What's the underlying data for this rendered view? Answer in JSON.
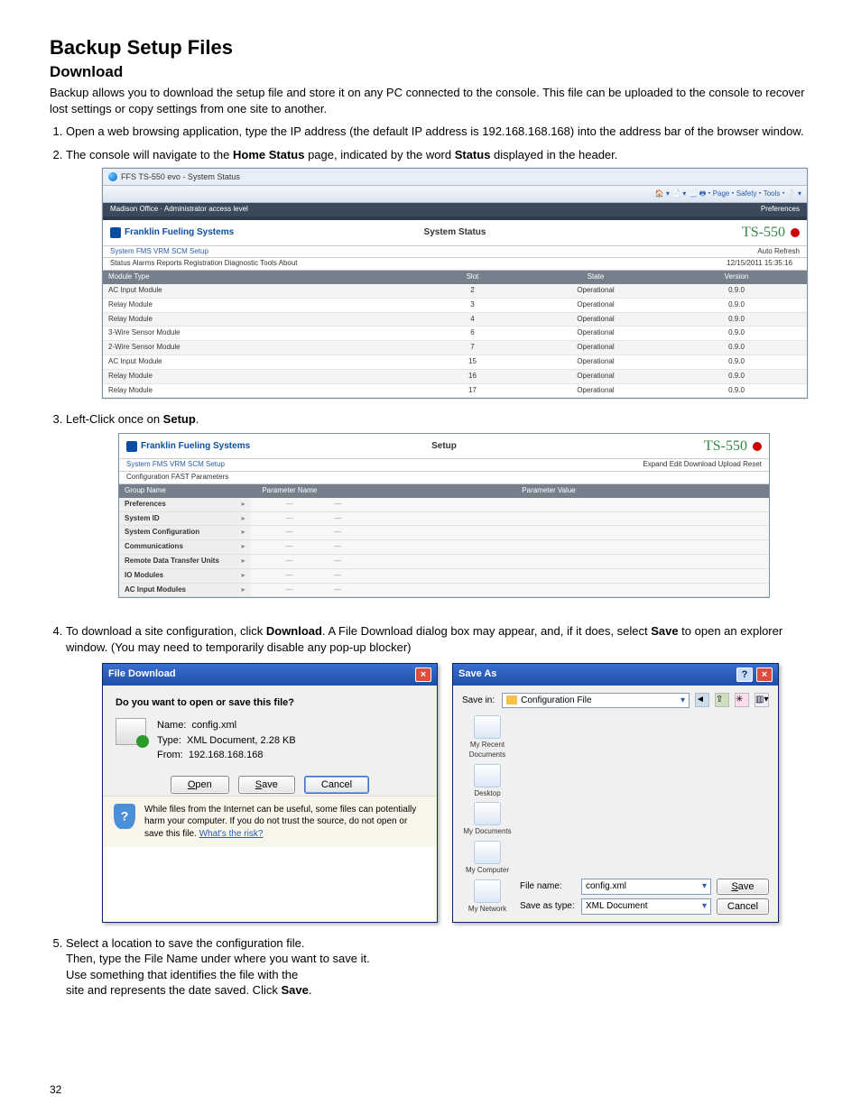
{
  "page_number": "32",
  "headings": {
    "title": "Backup Setup Files",
    "subtitle": "Download"
  },
  "intro": "Backup allows you to download the setup file and store it on any PC connected to the console. This file can be uploaded to the console to recover lost settings or copy settings from one site to another.",
  "steps": {
    "s1a": "Open a web browsing application, type the IP address (the default IP address is 192.168.168.168) into the address bar of the browser window.",
    "s2a": "The console will navigate to the ",
    "s2b": "Home Status",
    "s2c": " page, indicated by the word ",
    "s2d": "Status",
    "s2e": " displayed in the header.",
    "s3a": "Left-Click once on ",
    "s3b": "Setup",
    "s3c": ".",
    "s4a": "To download a site configuration, click ",
    "s4b": "Download",
    "s4c": ". A File Download dialog box may appear, and, if it does, select ",
    "s4d": "Save",
    "s4e": " to open an explorer window.  (You may need to temporarily disable any pop-up blocker)",
    "s5a": "Select a location to save the configuration file.",
    "s5b": "Then, type the File Name under where you want to save it.",
    "s5c": "Use something that identifies the file with the",
    "s5d": "site and represents the date saved. Click ",
    "s5e": "Save",
    "s5f": "."
  },
  "shot1": {
    "tab_title": "FFS TS-550 evo - System Status",
    "ie_menu": "Page ▾   Safety ▾   Tools ▾",
    "site_bar_left": "Madison Office · Administrator access level",
    "site_bar_right": "Preferences",
    "brand": "Franklin Fueling Systems",
    "page_title": "System Status",
    "model": "TS-550",
    "nav_left": "System   FMS   VRM   SCM   Setup",
    "nav_right": "Auto Refresh",
    "sub_left": "Status   Alarms   Reports   Registration   Diagnostic   Tools   About",
    "timestamp": "12/15/2011 15:35:16",
    "cols": {
      "c1": "Module Type",
      "c2": "Slot",
      "c3": "State",
      "c4": "Version"
    },
    "rows": [
      {
        "t": "AC Input Module",
        "s": "2",
        "st": "Operational",
        "v": "0.9.0"
      },
      {
        "t": "Relay Module",
        "s": "3",
        "st": "Operational",
        "v": "0.9.0"
      },
      {
        "t": "Relay Module",
        "s": "4",
        "st": "Operational",
        "v": "0.9.0"
      },
      {
        "t": "3-Wire Sensor Module",
        "s": "6",
        "st": "Operational",
        "v": "0.9.0"
      },
      {
        "t": "2-Wire Sensor Module",
        "s": "7",
        "st": "Operational",
        "v": "0.9.0"
      },
      {
        "t": "AC Input Module",
        "s": "15",
        "st": "Operational",
        "v": "0.9.0"
      },
      {
        "t": "Relay Module",
        "s": "16",
        "st": "Operational",
        "v": "0.9.0"
      },
      {
        "t": "Relay Module",
        "s": "17",
        "st": "Operational",
        "v": "0.9.0"
      }
    ]
  },
  "shot2": {
    "brand": "Franklin Fueling Systems",
    "page_title": "Setup",
    "model": "TS-550",
    "nav_left": "System   FMS   VRM   SCM   Setup",
    "nav_right": "Expand   Edit   Download   Upload   Reset",
    "sub_left": "Configuration   FAST   Parameters",
    "cols": {
      "c1": "Group Name",
      "c2": "Parameter Name",
      "c3": "Parameter Value"
    },
    "rows": [
      {
        "g": "Preferences"
      },
      {
        "g": "System ID"
      },
      {
        "g": "System Configuration"
      },
      {
        "g": "Communications"
      },
      {
        "g": "Remote Data Transfer Units"
      },
      {
        "g": "IO Modules"
      },
      {
        "g": "AC Input Modules"
      }
    ]
  },
  "dlg1": {
    "title": "File Download",
    "question": "Do you want to open or save this file?",
    "name_lbl": "Name:",
    "name_val": "config.xml",
    "type_lbl": "Type:",
    "type_val": "XML Document, 2.28 KB",
    "from_lbl": "From:",
    "from_val": "192.168.168.168",
    "btn_open": "Open",
    "btn_save": "Save",
    "btn_cancel": "Cancel",
    "warn": "While files from the Internet can be useful, some files can potentially harm your computer. If you do not trust the source, do not open or save this file. ",
    "warn_link": "What's the risk?"
  },
  "dlg2": {
    "title": "Save As",
    "savein": "Save in:",
    "folder": "Configuration File",
    "places": {
      "recent": "My Recent Documents",
      "desktop": "Desktop",
      "mydocs": "My Documents",
      "mycomp": "My Computer",
      "mynet": "My Network"
    },
    "filename_lbl": "File name:",
    "filename_val": "config.xml",
    "type_lbl": "Save as type:",
    "type_val": "XML Document",
    "btn_save": "Save",
    "btn_cancel": "Cancel"
  }
}
